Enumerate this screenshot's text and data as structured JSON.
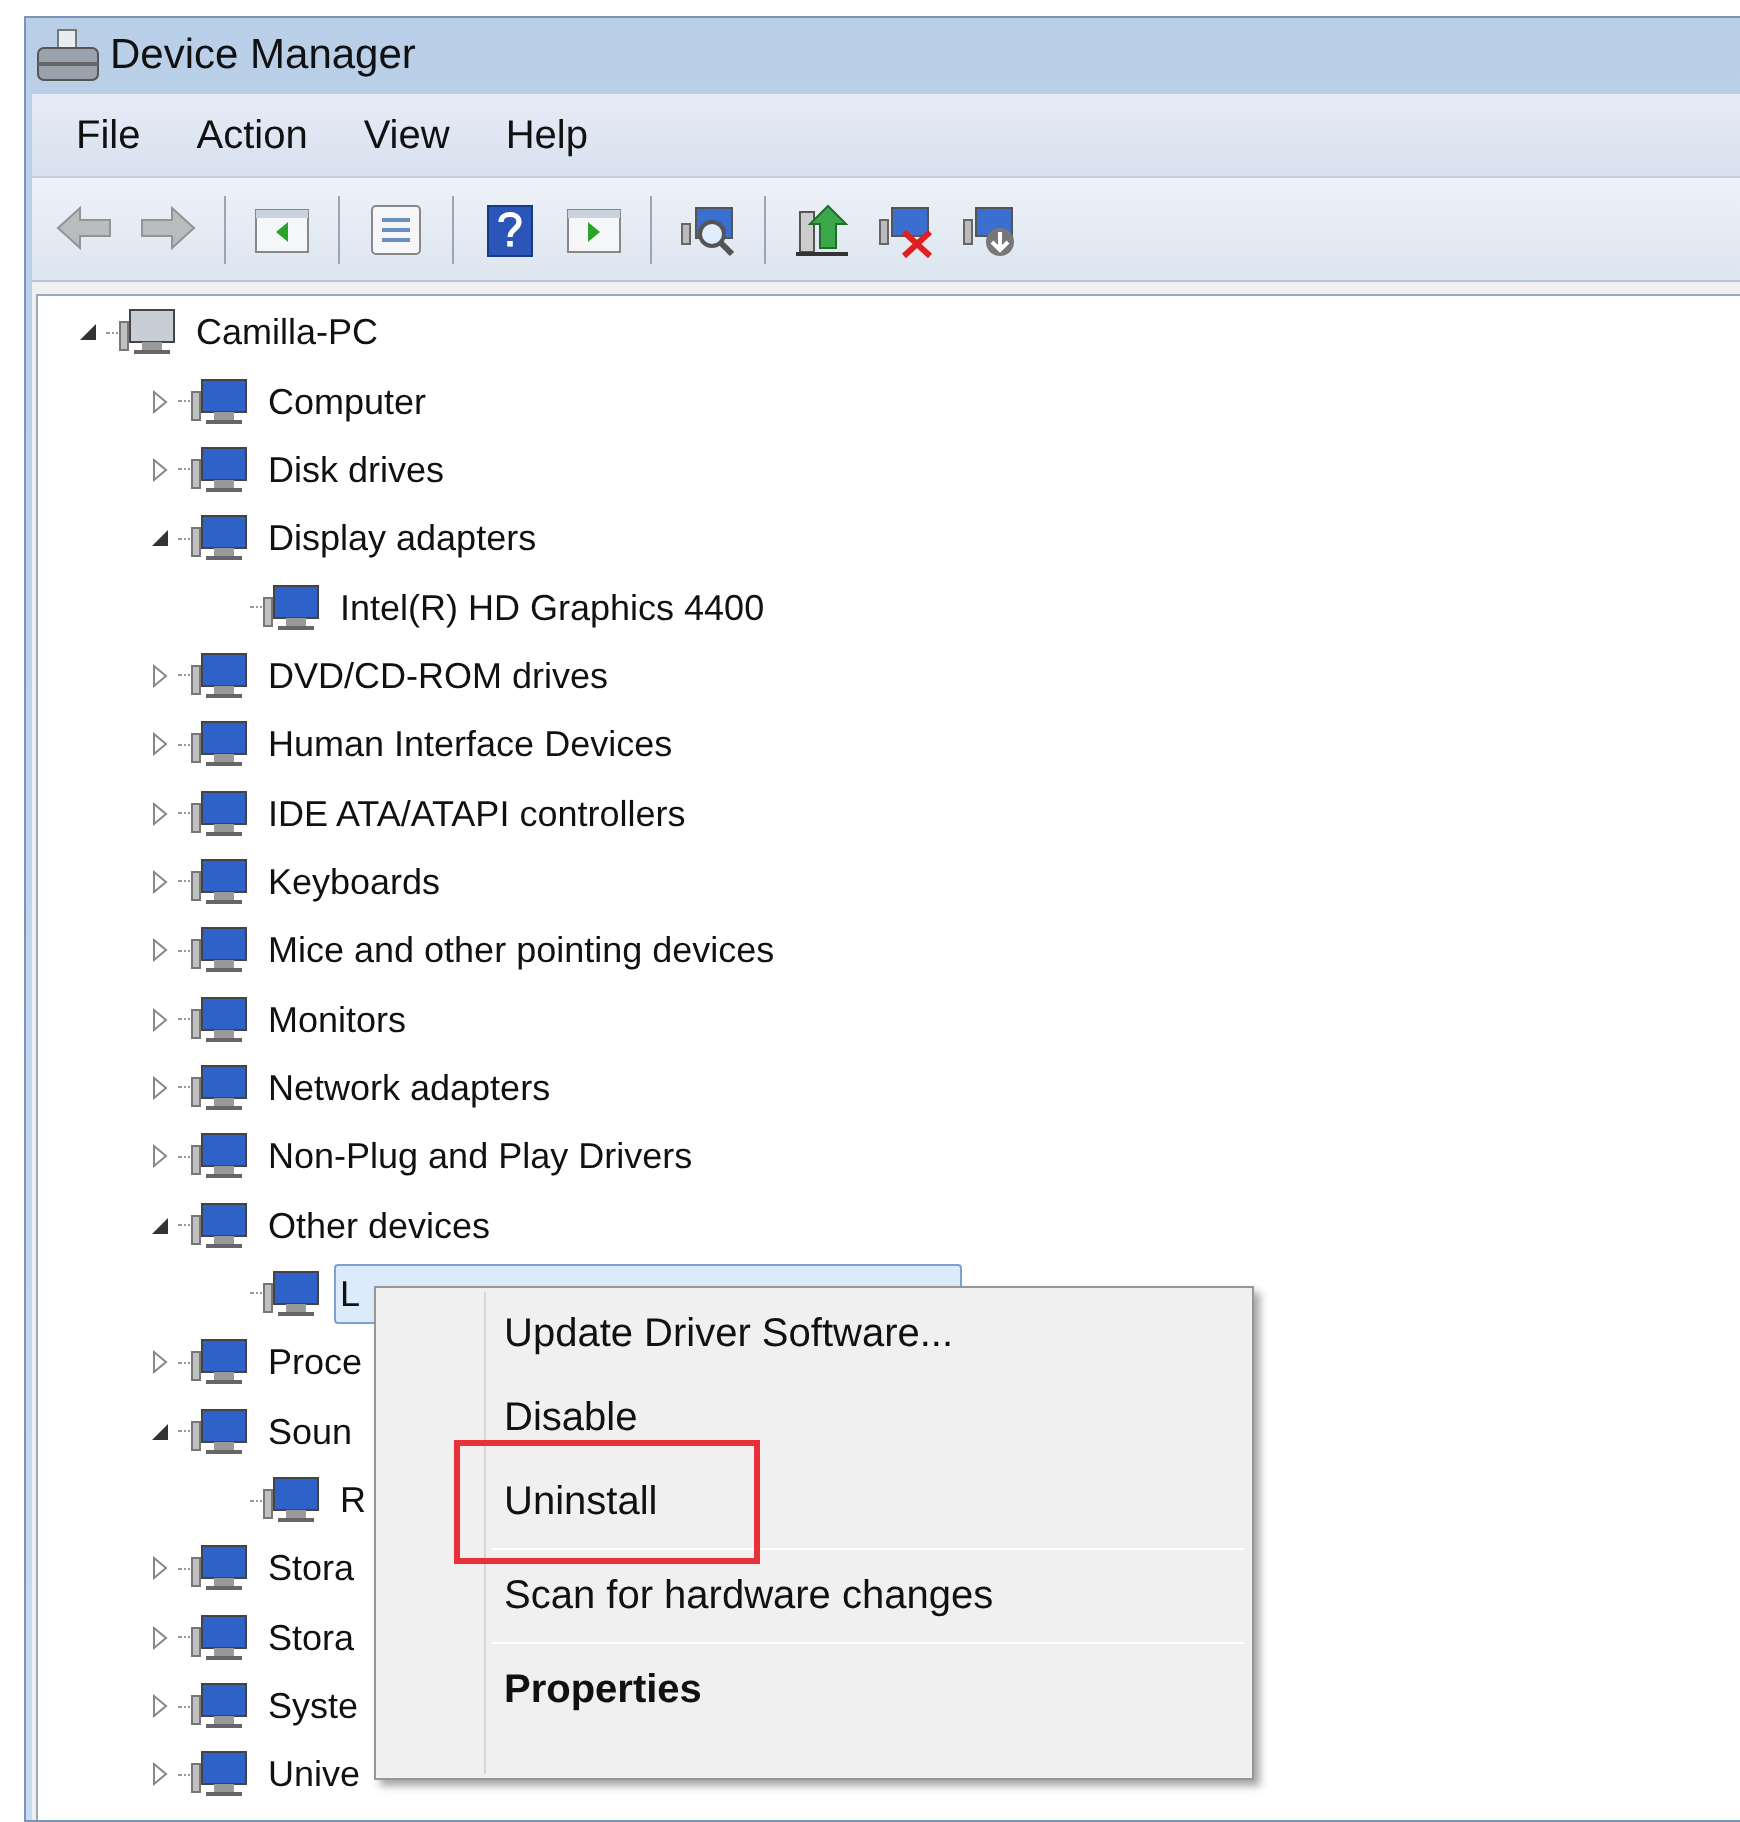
{
  "window": {
    "title": "Device Manager"
  },
  "menu_bar": [
    "File",
    "Action",
    "View",
    "Help"
  ],
  "toolbar": {
    "buttons": [
      {
        "kind": "back",
        "disabled": true
      },
      {
        "kind": "forward",
        "disabled": true
      },
      {
        "kind": "separator"
      },
      {
        "kind": "tree"
      },
      {
        "kind": "separator"
      },
      {
        "kind": "properties"
      },
      {
        "kind": "separator"
      },
      {
        "kind": "help"
      },
      {
        "kind": "pane"
      },
      {
        "kind": "separator"
      },
      {
        "kind": "scan"
      },
      {
        "kind": "separator"
      },
      {
        "kind": "update"
      },
      {
        "kind": "uninstall"
      },
      {
        "kind": "disable"
      }
    ]
  },
  "tree": [
    {
      "label": "Camilla-PC",
      "expanded": true,
      "selected": false,
      "children": [
        {
          "label": "Computer",
          "expanded": false,
          "selected": false
        },
        {
          "label": "Disk drives",
          "expanded": false,
          "selected": false
        },
        {
          "label": "Display adapters",
          "expanded": true,
          "selected": false,
          "children": [
            {
              "label": "Intel(R) HD Graphics 4400",
              "selected": false
            }
          ]
        },
        {
          "label": "DVD/CD-ROM drives",
          "expanded": false,
          "selected": false
        },
        {
          "label": "Human Interface Devices",
          "expanded": false,
          "selected": false
        },
        {
          "label": "IDE ATA/ATAPI controllers",
          "expanded": false,
          "selected": false
        },
        {
          "label": "Keyboards",
          "expanded": false,
          "selected": false
        },
        {
          "label": "Mice and other pointing devices",
          "expanded": false,
          "selected": false
        },
        {
          "label": "Monitors",
          "expanded": false,
          "selected": false
        },
        {
          "label": "Network adapters",
          "expanded": false,
          "selected": false
        },
        {
          "label": "Non-Plug and Play Drivers",
          "expanded": false,
          "selected": false
        },
        {
          "label": "Other devices",
          "expanded": true,
          "selected": false,
          "children": [
            {
              "label": "L",
              "selected": true
            }
          ]
        },
        {
          "label": "Proce",
          "expanded": false,
          "selected": false
        },
        {
          "label": "Soun",
          "expanded": true,
          "selected": false,
          "children": [
            {
              "label": "R",
              "selected": false
            }
          ]
        },
        {
          "label": "Stora",
          "expanded": false,
          "selected": false
        },
        {
          "label": "Stora",
          "expanded": false,
          "selected": false
        },
        {
          "label": "Syste",
          "expanded": false,
          "selected": false
        },
        {
          "label": "Unive",
          "expanded": false,
          "selected": false
        }
      ]
    }
  ],
  "context_menu": {
    "items": [
      {
        "kind": "item",
        "label": "Update Driver Software...",
        "bold": false,
        "highlighted": false
      },
      {
        "kind": "item",
        "label": "Disable",
        "bold": false,
        "highlighted": false
      },
      {
        "kind": "item",
        "label": "Uninstall",
        "bold": false,
        "highlighted": true
      },
      {
        "kind": "separator"
      },
      {
        "kind": "item",
        "label": "Scan for hardware changes",
        "bold": false,
        "highlighted": false
      },
      {
        "kind": "separator"
      },
      {
        "kind": "item",
        "label": "Properties",
        "bold": true,
        "highlighted": false
      }
    ]
  }
}
